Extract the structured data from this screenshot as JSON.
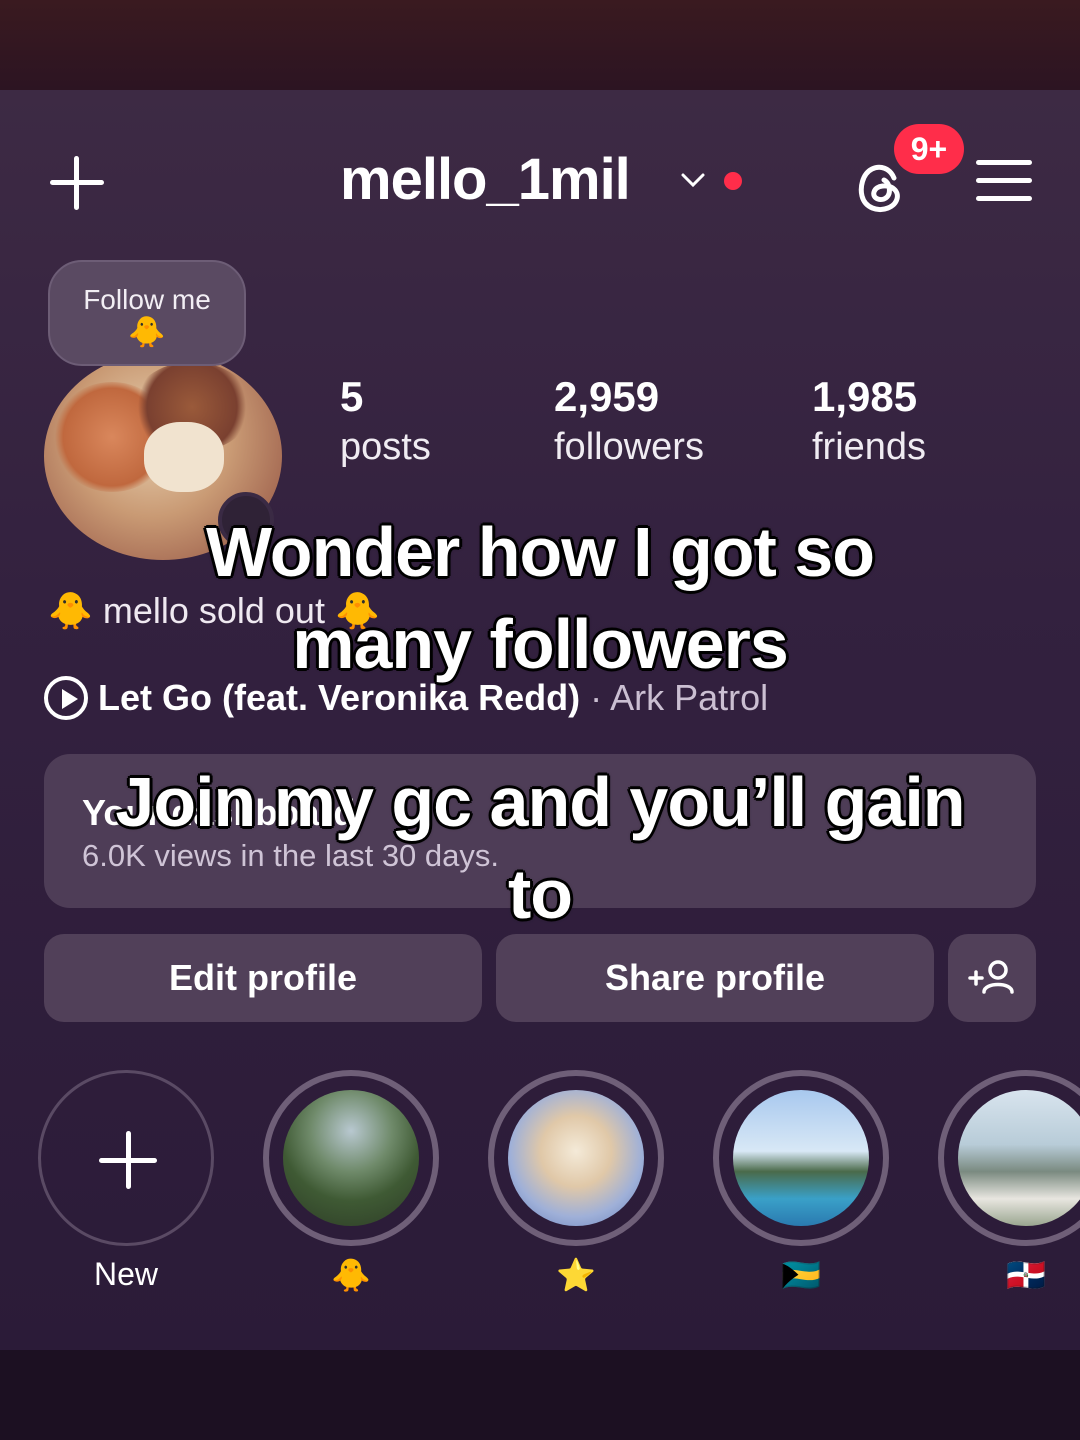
{
  "header": {
    "username": "mello_1mil",
    "notification_badge": "9+",
    "icons": [
      "plus-icon",
      "chevron-down-icon",
      "threads-icon",
      "menu-icon"
    ],
    "live_dot_color": "#ff2d4a"
  },
  "note": {
    "text": "Follow me",
    "emoji": "🐥"
  },
  "stats": [
    {
      "value": "5",
      "label": "posts"
    },
    {
      "value": "2,959",
      "label": "followers"
    },
    {
      "value": "1,985",
      "label": "friends"
    }
  ],
  "bio": {
    "text": "🐥 mello sold out 🐥"
  },
  "music": {
    "song": "Let Go (feat. Veronika Redd)",
    "artist": "· Ark Patrol"
  },
  "dashboard": {
    "title": "Your dashboard",
    "subtitle": "6.0K views in the last 30 days."
  },
  "buttons": {
    "edit": "Edit profile",
    "share": "Share profile"
  },
  "highlights": [
    {
      "label": "New"
    },
    {
      "label": "🐥"
    },
    {
      "label": "⭐"
    },
    {
      "label": "🇧🇸"
    },
    {
      "label": "🇩🇴"
    }
  ],
  "captions": {
    "line1": "Wonder how I got so many followers",
    "line2": "Join my gc and you’ll gain to"
  }
}
